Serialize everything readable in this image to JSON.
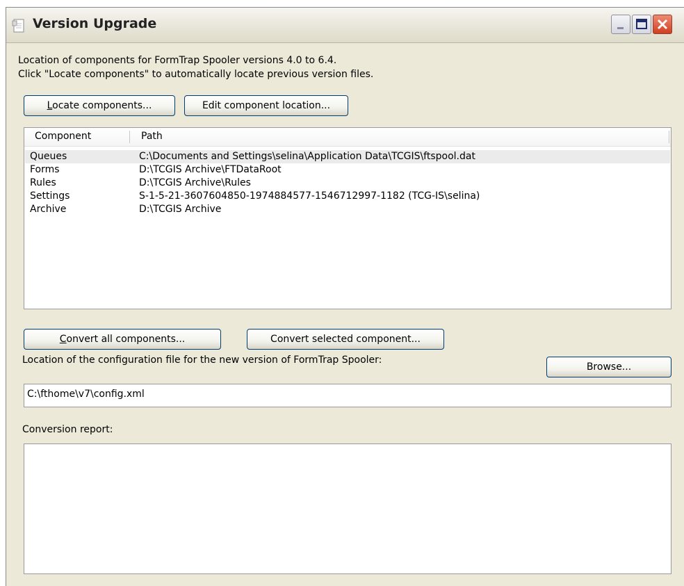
{
  "window": {
    "title": "Version Upgrade"
  },
  "intro": {
    "line1": "Location of components for FormTrap Spooler versions 4.0 to 6.4.",
    "line2": "Click \"Locate components\" to automatically locate previous version files."
  },
  "buttons": {
    "locate": {
      "mnemonic": "L",
      "rest": "ocate components..."
    },
    "edit_location": "Edit component location...",
    "convert_all": {
      "mnemonic": "C",
      "rest": "onvert all components..."
    },
    "convert_selected": "Convert selected component...",
    "browse": "Browse..."
  },
  "components_table": {
    "columns": [
      "Component",
      "Path"
    ],
    "rows": [
      {
        "component": "Queues",
        "path": "C:\\Documents and Settings\\selina\\Application Data\\TCGIS\\ftspool.dat",
        "selected": true
      },
      {
        "component": "Forms",
        "path": "D:\\TCGIS Archive\\FTDataRoot",
        "selected": false
      },
      {
        "component": "Rules",
        "path": "D:\\TCGIS Archive\\Rules",
        "selected": false
      },
      {
        "component": "Settings",
        "path": "S-1-5-21-3607604850-1974884577-1546712997-1182 (TCG-IS\\selina)",
        "selected": false
      },
      {
        "component": "Archive",
        "path": "D:\\TCGIS Archive",
        "selected": false
      }
    ]
  },
  "config": {
    "label": "Location of the configuration file for the new version of FormTrap Spooler:",
    "value": "C:\\fthome\\v7\\config.xml"
  },
  "report": {
    "label": "Conversion report:",
    "value": ""
  },
  "colors": {
    "dialog_bg": "#ece9d8",
    "button_border": "#003c74",
    "close_button": "#cf3f22",
    "selected_row": "#ebebeb"
  }
}
